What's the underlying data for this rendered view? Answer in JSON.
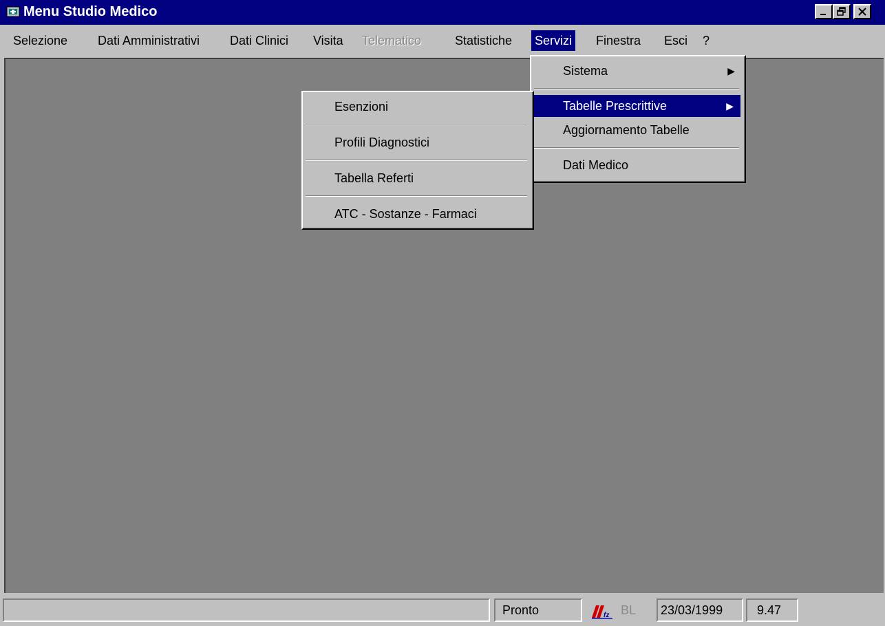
{
  "window": {
    "title": "Menu Studio Medico",
    "app_icon": "medical-app-icon",
    "controls": [
      "minimize",
      "restore",
      "close"
    ]
  },
  "menubar": [
    {
      "label": "Selezione",
      "shortcut": "S"
    },
    {
      "label": "Dati Amministrativi",
      "shortcut": "D"
    },
    {
      "label": "Dati Clinici",
      "shortcut": "C"
    },
    {
      "label": "Visita",
      "shortcut": "V"
    },
    {
      "label": "Telematico",
      "shortcut": "T",
      "disabled": true
    },
    {
      "label": "Statistiche",
      "shortcut": "a"
    },
    {
      "label": "Servizi",
      "shortcut": "r",
      "active": true
    },
    {
      "label": "Finestra",
      "shortcut": "F"
    },
    {
      "label": "Esci",
      "shortcut": "E"
    },
    {
      "label": "?",
      "shortcut": "?"
    }
  ],
  "servizi_menu": {
    "items": [
      {
        "label": "Sistema",
        "has_submenu": true
      },
      {
        "label": "Tabelle Prescrittive",
        "has_submenu": true,
        "highlighted": true
      },
      {
        "label": "Aggiornamento Tabelle"
      },
      {
        "label": "Dati Medico"
      }
    ]
  },
  "tabelle_submenu": {
    "items": [
      {
        "label": "Esenzioni"
      },
      {
        "label": "Profili Diagnostici"
      },
      {
        "label": "Tabella Referti"
      },
      {
        "label": "ATC - Sostanze - Farmaci"
      }
    ]
  },
  "statusbar": {
    "status": "Pronto",
    "indicator": "BL",
    "date": "23/03/1999",
    "time": "9.47",
    "logo": "vendor-logo-icon"
  },
  "colors": {
    "title_bg": "#000080",
    "face": "#c0c0c0",
    "mdi_bg": "#808080",
    "highlight": "#000080"
  }
}
